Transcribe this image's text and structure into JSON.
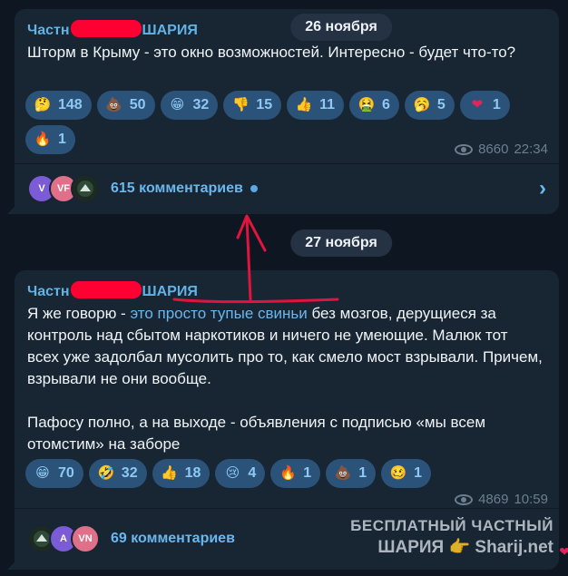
{
  "dates": [
    "26 ноября",
    "27 ноября"
  ],
  "messages": [
    {
      "author_prefix": "Частн",
      "author_suffix": "ШАРИЯ",
      "text": "Шторм в Крыму - это окно возможностей. Интересно - будет что-то?",
      "reactions": [
        {
          "icon": "thinking-face-icon",
          "glyph": "🤔",
          "count": "148"
        },
        {
          "icon": "poop-icon",
          "glyph": "💩",
          "count": "50"
        },
        {
          "icon": "grinning-face-icon",
          "glyph": "😁",
          "count": "32"
        },
        {
          "icon": "thumbs-down-icon",
          "glyph": "👎",
          "count": "15"
        },
        {
          "icon": "thumbs-up-icon",
          "glyph": "👍",
          "count": "11"
        },
        {
          "icon": "vomiting-face-icon",
          "glyph": "🤮",
          "count": "6"
        },
        {
          "icon": "yawning-face-icon",
          "glyph": "🥱",
          "count": "5"
        },
        {
          "icon": "heart-icon",
          "glyph": "❤",
          "count": "1"
        },
        {
          "icon": "fire-icon",
          "glyph": "🔥",
          "count": "1"
        }
      ],
      "views": "8660",
      "time": "22:34",
      "comments_label": "615 комментариев",
      "avatars": [
        "V",
        "VF",
        ""
      ]
    },
    {
      "author_prefix": "Частн",
      "author_suffix": "ШАРИЯ",
      "text_before": "Я же говорю - ",
      "text_link": "это просто тупые свиньи",
      "text_after": " без мозгов, дерущиеся за контроль над сбытом наркотиков и ничего не умеющие. Малюк тот всех уже задолбал мусолить про то, как смело мост взрывали. Причем, взрывали не они вообще.\n\nПафосу полно, а на выходе - объявления с подписью «мы всем отомстим» на заборе",
      "reactions": [
        {
          "icon": "grinning-face-icon",
          "glyph": "😁",
          "count": "70"
        },
        {
          "icon": "rofl-face-icon",
          "glyph": "🤣",
          "count": "32"
        },
        {
          "icon": "thumbs-up-icon",
          "glyph": "👍",
          "count": "18"
        },
        {
          "icon": "crying-face-icon",
          "glyph": "😢",
          "count": "4"
        },
        {
          "icon": "fire-icon",
          "glyph": "🔥",
          "count": "1"
        },
        {
          "icon": "poop-icon",
          "glyph": "💩",
          "count": "1"
        },
        {
          "icon": "woozy-face-icon",
          "glyph": "🥴",
          "count": "1"
        }
      ],
      "views": "4869",
      "time": "10:59",
      "comments_label": "69 комментариев",
      "avatars": [
        "",
        "A",
        "VN"
      ]
    }
  ],
  "watermark": {
    "line1": "БЕСПЛАТНЫЙ ЧАСТНЫЙ",
    "line2_a": "ШАРИЯ",
    "line2_b": "Sharij.net"
  },
  "colors": {
    "accent": "#6ab7ee",
    "redact": "#ff0033",
    "arrow": "#e0143c",
    "reaction_bg": "#2b5278"
  }
}
